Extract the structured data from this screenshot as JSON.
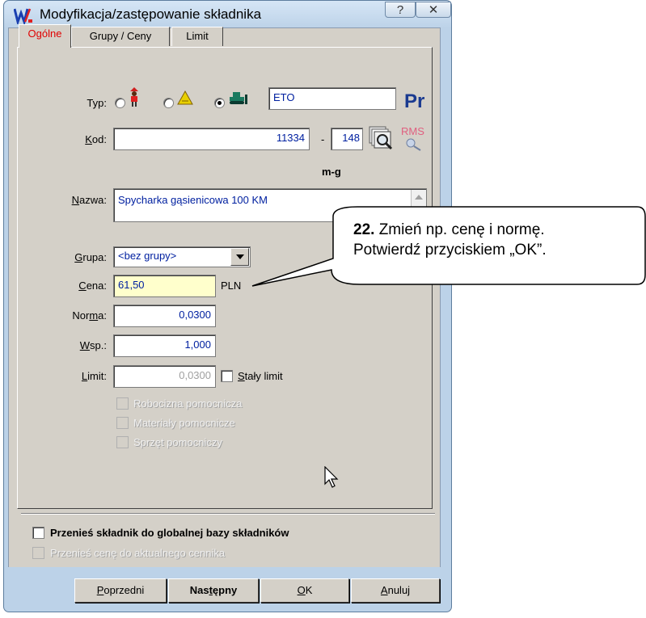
{
  "window": {
    "title": "Modyfikacja/zastępowanie składnika",
    "help": "?",
    "close": "✕"
  },
  "tabs": [
    {
      "label": "Ogólne"
    },
    {
      "label": "Grupy / Ceny"
    },
    {
      "label": "Limit"
    }
  ],
  "form": {
    "typ_label": "Typ:",
    "typ_value": "ETO",
    "typ_badge": "Pr",
    "kod_label_u": "K",
    "kod_label_rest": "od:",
    "kod_value": "11334",
    "kod_dash": "-",
    "kod_suffix": "148",
    "rms": "RMS",
    "unit": "m-g",
    "nazwa_label_u": "N",
    "nazwa_label_rest": "azwa:",
    "nazwa_value": "Spycharka gąsienicowa 100 KM",
    "grupa_label_u": "G",
    "grupa_label_rest": "rupa:",
    "grupa_value": "<bez grupy>",
    "cena_label_u": "C",
    "cena_label_rest": "ena:",
    "cena_value": "61,50",
    "currency": "PLN",
    "norma_label_a": "Nor",
    "norma_label_u": "m",
    "norma_label_b": "a:",
    "norma_value": "0,0300",
    "wsp_label_u": "W",
    "wsp_label_rest": "sp.:",
    "wsp_value": "1,000",
    "limit_label_u": "L",
    "limit_label_rest": "imit:",
    "limit_value": "0,0300",
    "staly_u": "S",
    "staly_rest": "tały limit",
    "robocizna": "Robocizna pomocnicza",
    "materialy": "Materiały pomocnicze",
    "sprzet": "Sprzęt pomocniczy",
    "global": "Przenieś składnik do globalnej bazy składników",
    "cennik": "Przenieś cenę do aktualnego cennika"
  },
  "buttons": {
    "prev_u": "P",
    "prev_rest": "oprzedni",
    "next_a": "Nas",
    "next_u": "t",
    "next_b": "ępny",
    "ok_u": "O",
    "ok_rest": "K",
    "cancel_u": "A",
    "cancel_rest": "nuluj"
  },
  "callout": {
    "number": "22.",
    "line1": "Zmień np. cenę i normę.",
    "line2": "Potwierdź przyciskiem „OK”."
  }
}
